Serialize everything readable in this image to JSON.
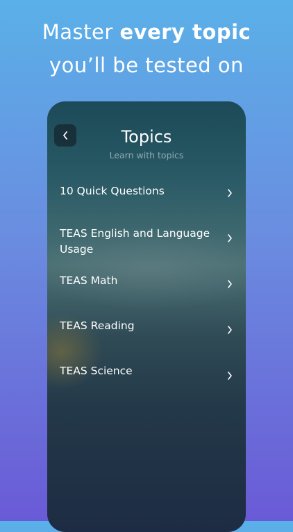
{
  "headline": {
    "line1_prefix": "Master ",
    "line1_bold": "every topic",
    "line2": "you’ll be tested on"
  },
  "screen": {
    "title": "Topics",
    "subtitle": "Learn with topics",
    "back_icon": "chevron-left-icon"
  },
  "topics": [
    {
      "label": "10 Quick Questions"
    },
    {
      "label": "TEAS English and Language Usage"
    },
    {
      "label": "TEAS Math"
    },
    {
      "label": "TEAS Reading"
    },
    {
      "label": "TEAS Science"
    }
  ],
  "colors": {
    "background_top": "#5ab0e8",
    "background_bottom": "#6a5ad6",
    "text": "#ffffff"
  }
}
